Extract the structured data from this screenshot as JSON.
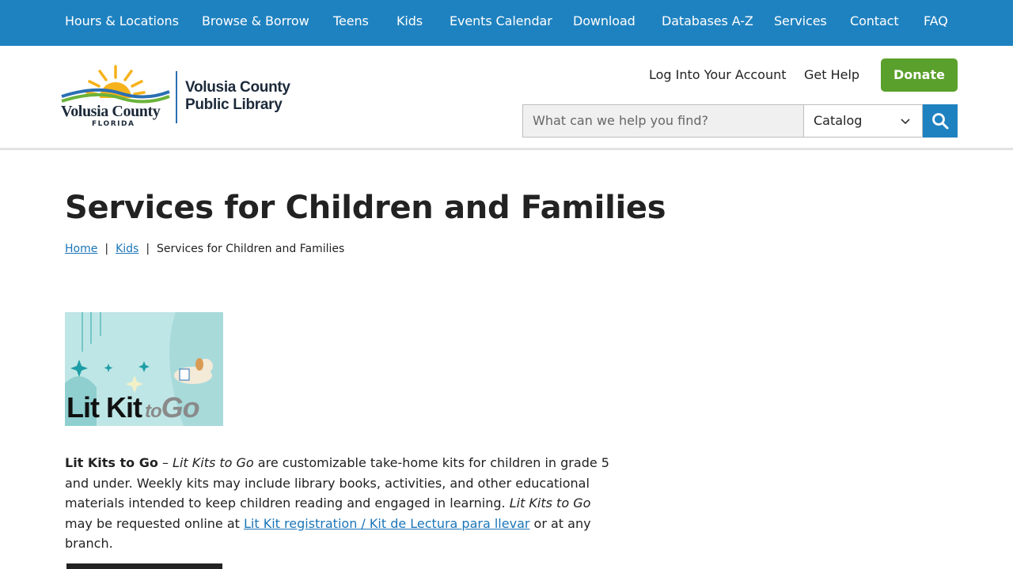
{
  "nav": {
    "items": [
      {
        "label": "Hours & Locations"
      },
      {
        "label": "Browse & Borrow"
      },
      {
        "label": "Teens"
      },
      {
        "label": "Kids"
      },
      {
        "label": "Events Calendar"
      },
      {
        "label": "Download"
      },
      {
        "label": "Databases A-Z"
      },
      {
        "label": "Services"
      },
      {
        "label": "Contact"
      },
      {
        "label": "FAQ"
      }
    ]
  },
  "header": {
    "logo": {
      "county": "Volusia County",
      "state": "FLORIDA",
      "library_line1": "Volusia County",
      "library_line2": "Public Library"
    },
    "login_label": "Log Into Your Account",
    "help_label": "Get Help",
    "donate_label": "Donate",
    "search": {
      "placeholder": "What can we help you find?",
      "scope": "Catalog",
      "button_icon": "search-icon"
    }
  },
  "page": {
    "title": "Services for Children and Families",
    "breadcrumb": {
      "home": "Home",
      "kids": "Kids",
      "sep": "|",
      "current": "Services for Children and Families"
    },
    "kit_image": {
      "title_lit": "Lit Kit",
      "title_to": "to",
      "title_go": "Go"
    },
    "lit_kits": {
      "heading": "Lit Kits to Go",
      "dash": " – ",
      "name1": "Lit Kits to Go",
      "text1": " are customizable take-home kits for children in grade 5 and under.  Weekly kits may include library books, activities, and other educational materials intended to keep children reading and engaged in learning.  ",
      "name2": "Lit Kits to Go",
      "text2": " may be requested online at ",
      "link": "Lit Kit registration / Kit de Lectura para llevar",
      "text3": " or at any branch."
    }
  },
  "colors": {
    "nav_bg": "#1f82c0",
    "donate_bg": "#5aa02c",
    "link": "#1a75b8"
  }
}
